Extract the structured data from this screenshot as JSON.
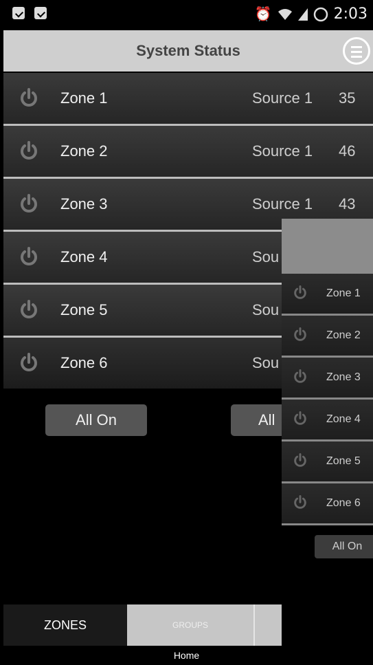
{
  "status_bar": {
    "time": "2:03",
    "icons": [
      "notification-bag-icon",
      "notification-bag-icon",
      "alarm-icon",
      "wifi-icon",
      "signal-icon",
      "battery-icon"
    ]
  },
  "header": {
    "title": "System Status",
    "menu_icon": "hamburger-menu-icon"
  },
  "zones": [
    {
      "name": "Zone 1",
      "source": "Source 1",
      "volume": "35"
    },
    {
      "name": "Zone 2",
      "source": "Source 1",
      "volume": "46"
    },
    {
      "name": "Zone 3",
      "source": "Source 1",
      "volume": "43"
    },
    {
      "name": "Zone 4",
      "source": "Sou",
      "volume": ""
    },
    {
      "name": "Zone 5",
      "source": "Sou",
      "volume": ""
    },
    {
      "name": "Zone 6",
      "source": "Sou",
      "volume": ""
    }
  ],
  "actions": {
    "all_on": "All On",
    "all_partial": "All"
  },
  "tabs": {
    "zones": "ZONES",
    "groups": "GROUPS"
  },
  "home_label": "Home",
  "overlay": {
    "zones": [
      "Zone 1",
      "Zone 2",
      "Zone 3",
      "Zone 4",
      "Zone 5",
      "Zone 6"
    ],
    "all_on": "All On"
  },
  "colors": {
    "header_bg": "#cfcfcf",
    "row_bg": "#333333",
    "divider": "#bdbdbd",
    "button_bg": "#555555"
  }
}
